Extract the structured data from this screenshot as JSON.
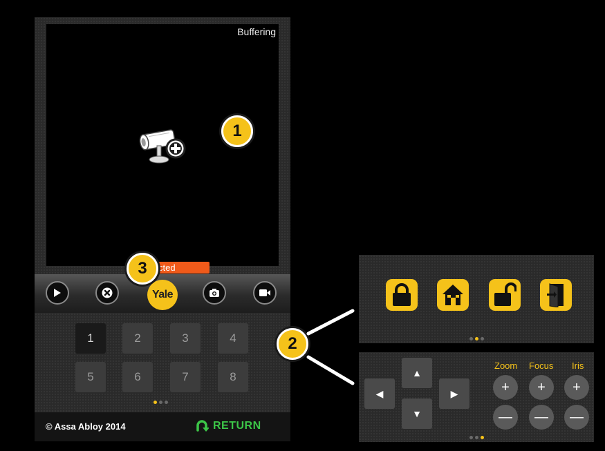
{
  "video": {
    "status_top": "Buffering",
    "status_bar": "cted"
  },
  "controls": {
    "play_icon": "play-icon",
    "close_icon": "close-icon",
    "yale_label": "Yale",
    "snapshot_icon": "camera-icon",
    "record_icon": "video-icon"
  },
  "keypad": {
    "keys": [
      "1",
      "2",
      "3",
      "4",
      "5",
      "6",
      "7",
      "8"
    ],
    "active_key": "1",
    "pager_active_index": 0
  },
  "footer": {
    "copyright": "© Assa Abloy 2014",
    "return_label": "RETURN"
  },
  "callouts": {
    "one": "1",
    "two": "2",
    "three": "3"
  },
  "lock_panel": {
    "buttons": [
      "lock-icon",
      "home-icon",
      "unlock-icon",
      "door-icon"
    ],
    "pager_active_index": 1
  },
  "ptz_panel": {
    "labels": {
      "zoom": "Zoom",
      "focus": "Focus",
      "iris": "Iris"
    },
    "plus": "+",
    "minus": "—",
    "arrows": {
      "up": "▲",
      "down": "▼",
      "left": "◀",
      "right": "▶"
    },
    "pager_active_index": 2
  },
  "colors": {
    "accent_yellow": "#f5c21a",
    "status_orange": "#f05a1a",
    "return_green": "#3cc648"
  }
}
